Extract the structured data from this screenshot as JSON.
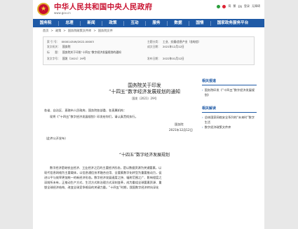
{
  "header": {
    "emblem_glyph": "★",
    "site_title": "中华人民共和国中央人民政府",
    "site_url": "www.gov.cn",
    "top_links": [
      "简",
      "繁",
      "EN",
      "登录",
      "无障碍"
    ]
  },
  "nav": {
    "items": [
      "国务院",
      "总理",
      "新闻",
      "政策",
      "互动",
      "服务",
      "数据",
      "国情",
      "国家政务服务平台"
    ]
  },
  "breadcrumb": [
    "首页",
    ">",
    "政策",
    ">",
    "国务院政策文件库",
    ">",
    "国务院文件"
  ],
  "meta": {
    "rows": [
      {
        "k": "索 引 号：",
        "v": "000014349/2022-00003"
      },
      {
        "k": "主题分类：",
        "v": "工业、交通\\信息产业（含电信）"
      },
      {
        "k": "发文机关：",
        "v": "国务院"
      },
      {
        "k": "成文日期：",
        "v": "2021年12月12日"
      },
      {
        "k": "标　　题：",
        "v": "国务院关于印发“十四五”数字经济发展规划的通知"
      },
      {
        "k": "发文字号：",
        "v": "国发〔2021〕29号"
      },
      {
        "k": "发布日期：",
        "v": "2022年01月12日"
      }
    ]
  },
  "document": {
    "title_line1": "国务院关于印发",
    "title_line2": "“十四五”数字经济发展规划的通知",
    "doc_no": "国发〔2021〕29号",
    "recipients": "各省、自治区、直辖市人民政府，国务院各部委、各直属机构：",
    "body1": "现将《“十四五”数字经济发展规划》印发给你们，请认真贯彻执行。",
    "signature": "国务院",
    "date": "2021年12月12日",
    "public_note": "（此件公开发布）",
    "plan_title": "“十四五”数字经济发展规划",
    "plan_p1": "数字经济是继农业经济、工业经济之后的主要经济形态，是以数据资源为关键要素，以",
    "plan_p2": "现代信息网络为主要载体，以信息通信技术融合应用、全要素数字化转型为重要推动力，促",
    "plan_p3": "进公平与效率更加统一的新经济形态。数字经济发展速度之快、辐射范围之广、影响程度之",
    "plan_p4": "深前所未有，正推动生产方式、生活方式和治理方式深刻变革，成为重组全球要素资源、重",
    "plan_p5": "塑全球经济结构、改变全球竞争格局的关键力量。“十四五”时期，我国数字经济转向深化"
  },
  "sidebar": {
    "related_title": "相关报道",
    "related_items": [
      "国务院印发《“十四五”数字经济发展规划》"
    ],
    "interp_title": "相关解读",
    "interp_items": [
      "总体国家网络安全系列的“未来时”数字生活",
      "数字经济政策文件库"
    ]
  }
}
